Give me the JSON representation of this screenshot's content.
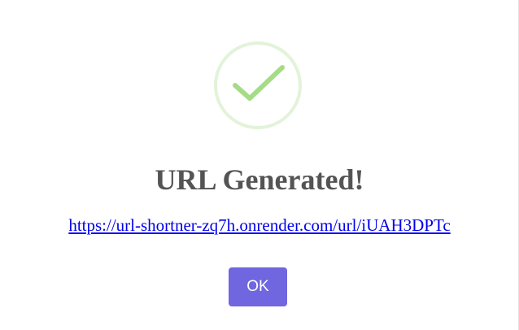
{
  "dialog": {
    "icon": "success-check-icon",
    "title": "URL Generated!",
    "link_text": "https://url-shortner-zq7h.onrender.com/url/iUAH3DPTc",
    "ok_label": "OK"
  },
  "colors": {
    "accent": "#7066e0",
    "success": "#a5dc86",
    "title": "#545454",
    "link": "#0000ee"
  }
}
